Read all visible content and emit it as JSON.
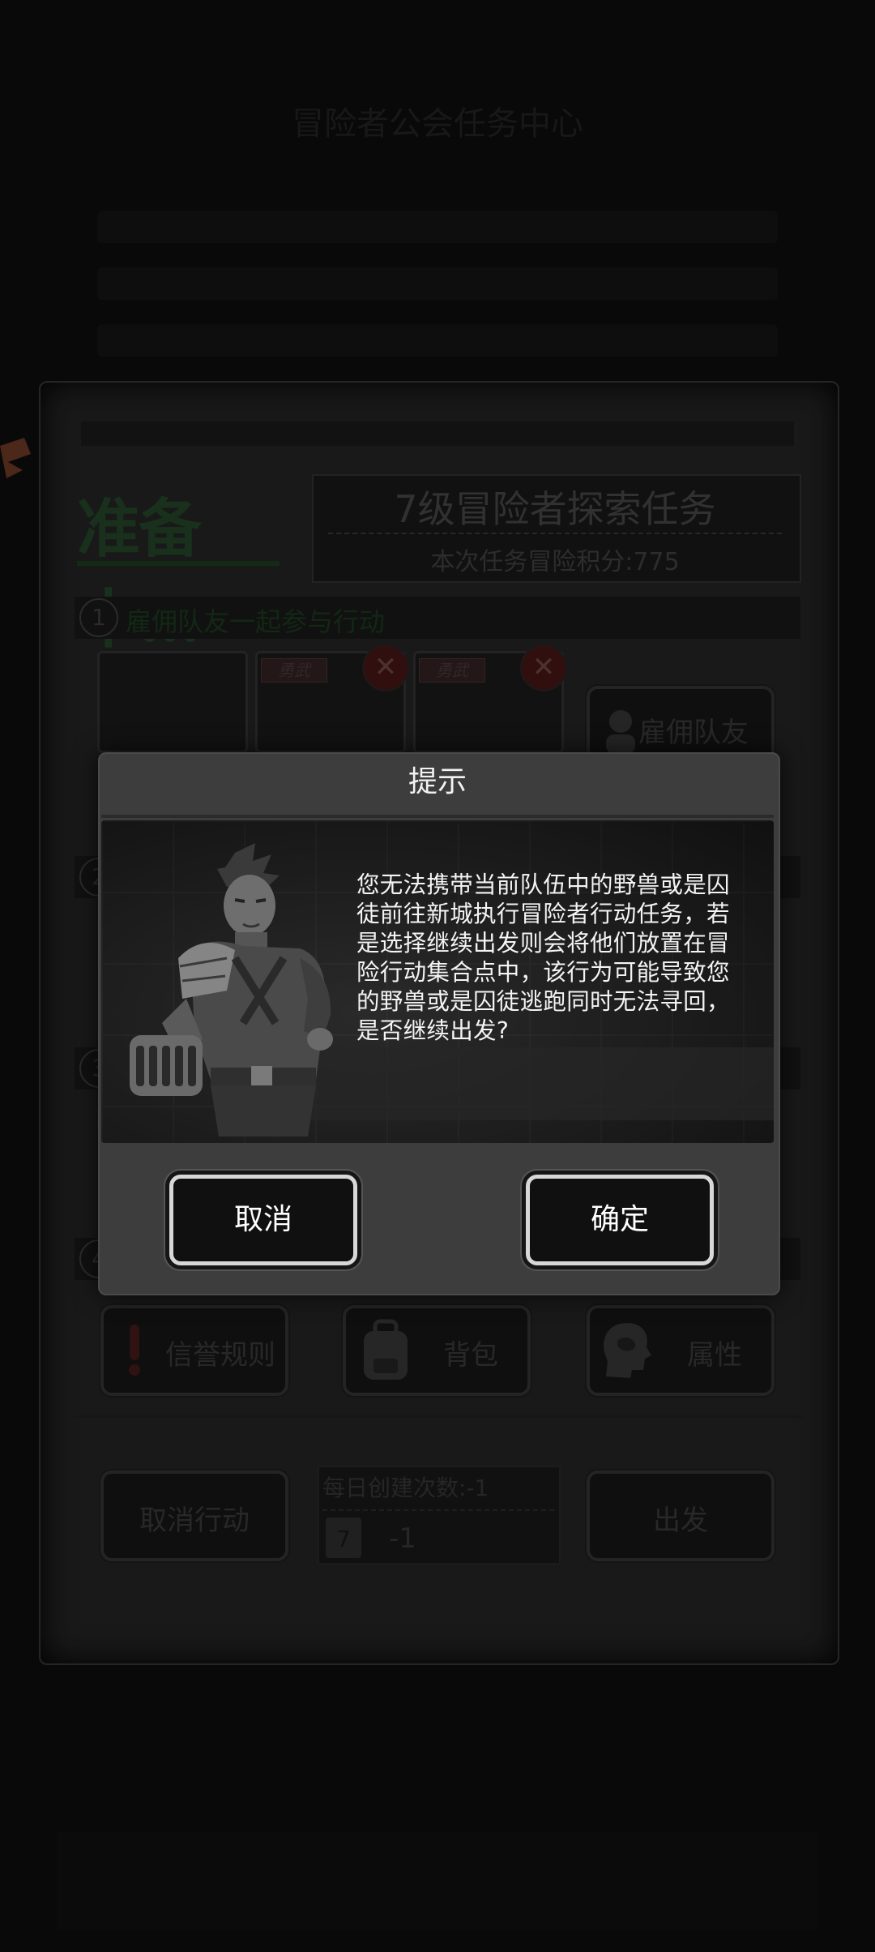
{
  "header": {
    "title": "冒险者公会任务中心"
  },
  "task": {
    "status": "准备中...",
    "title": "7级冒险者探索任务",
    "score": "本次任务冒险积分:775"
  },
  "steps": {
    "step1_num": "1",
    "step1_label": "雇佣队友一起参与行动",
    "step2_num": "2",
    "step3_num": "3",
    "step4_num": "4"
  },
  "party": {
    "badge1": "勇武",
    "badge2": "勇武",
    "remove_symbol": "✕",
    "hire_button": "雇佣队友"
  },
  "bottom_buttons": {
    "credit_rules": "信誉规则",
    "backpack": "背包",
    "attributes": "属性",
    "cancel_action": "取消行动",
    "depart": "出发"
  },
  "daily": {
    "label": "每日创建次数:-1",
    "value": "-1",
    "calendar_day": "7"
  },
  "dialog": {
    "title": "提示",
    "message": "您无法携带当前队伍中的野兽或是囚徒前往新城执行冒险者行动任务，若是选择继续出发则会将他们放置在冒险行动集合点中，该行为可能导致您的野兽或是囚徒逃跑同时无法寻回，是否继续出发?",
    "cancel_label": "取消",
    "confirm_label": "确定"
  },
  "icons": {
    "credit": "exclamation-icon",
    "backpack": "backpack-icon",
    "attributes": "head-brain-icon",
    "calendar": "calendar-icon",
    "hire": "person-search-icon"
  },
  "colors": {
    "dialog_bg": "#3d3d3d",
    "button_border": "#d8d8d8",
    "preparing_text": "#1e3a22",
    "remove_button": "#3b1212"
  }
}
